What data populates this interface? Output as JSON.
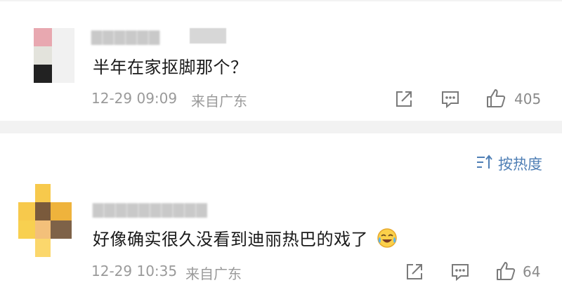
{
  "comments": [
    {
      "text": "半年在家抠脚那个？",
      "date": "12-29 09:09",
      "location": "来自广东",
      "likes": "405"
    },
    {
      "text": "好像确实很久没看到迪丽热巴的戏了",
      "date": "12-29 10:35",
      "location": "来自广东",
      "likes": "64",
      "emoji": "laughing-crying-emoji"
    }
  ],
  "sort": {
    "label": "按热度"
  },
  "colors": {
    "accent": "#4f7fb5",
    "meta": "#9a9a9a",
    "divider": "#f2f2f2"
  }
}
